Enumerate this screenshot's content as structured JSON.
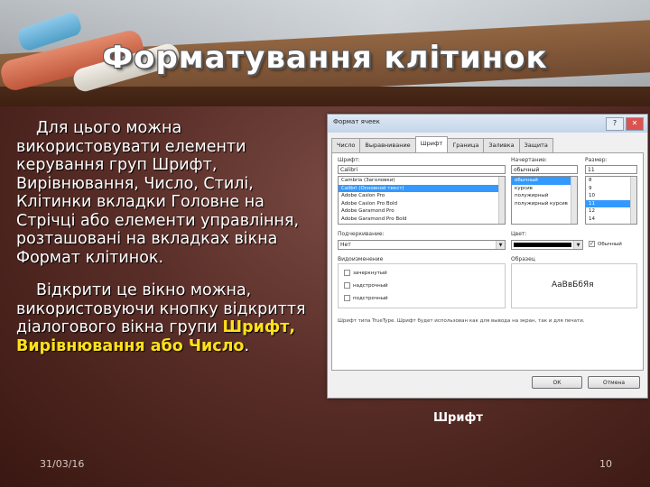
{
  "slide": {
    "title": "Форматування клітинок",
    "paragraph1": "Для цього можна використовувати елементи керування груп Шрифт, Вирівнювання, Число, Стилі, Клітинки вкладки Головне на Стрічці або елементи управління, розташовані на вкладках вікна Формат клітинок.",
    "paragraph2_text": "Відкрити це вікно можна, використовуючи кнопку відкриття діалогового вікна групи ",
    "paragraph2_highlight": "Шрифт, Вирівнювання або Число",
    "paragraph2_end": ".",
    "highlight_color": "#ffe11a",
    "caption": "Шрифт",
    "date": "31/03/16",
    "page": "10"
  },
  "dialog": {
    "title": "Формат ячеек",
    "help": "?",
    "close": "✕",
    "tabs": [
      "Число",
      "Выравнивание",
      "Шрифт",
      "Граница",
      "Заливка",
      "Защита"
    ],
    "active_tab": 2,
    "font_label": "Шрифт:",
    "font_value": "Calibri",
    "font_list": [
      "Cambria (Заголовки)",
      "Calibri (Основной текст)",
      "Adobe Caslon Pro",
      "Adobe Caslon Pro Bold",
      "Adobe Garamond Pro",
      "Adobe Garamond Pro Bold"
    ],
    "style_label": "Начертание:",
    "style_value": "обычный",
    "style_list": [
      "обычный",
      "курсив",
      "полужирный",
      "полужирный курсив"
    ],
    "size_label": "Размер:",
    "size_value": "11",
    "size_list": [
      "8",
      "9",
      "10",
      "11",
      "12",
      "14"
    ],
    "underline_label": "Подчеркивание:",
    "underline_value": "Нет",
    "color_label": "Цвет:",
    "normal_font_label": "Обычный",
    "effects_label": "Видоизменение",
    "effects": [
      "зачеркнутый",
      "надстрочный",
      "подстрочный"
    ],
    "sample_label": "Образец",
    "sample_text": "АаВвБбЯя",
    "footnote": "Шрифт типа TrueType. Шрифт будет использован как для вывода на экран, так и для печати.",
    "ok": "ОК",
    "cancel": "Отмена"
  }
}
